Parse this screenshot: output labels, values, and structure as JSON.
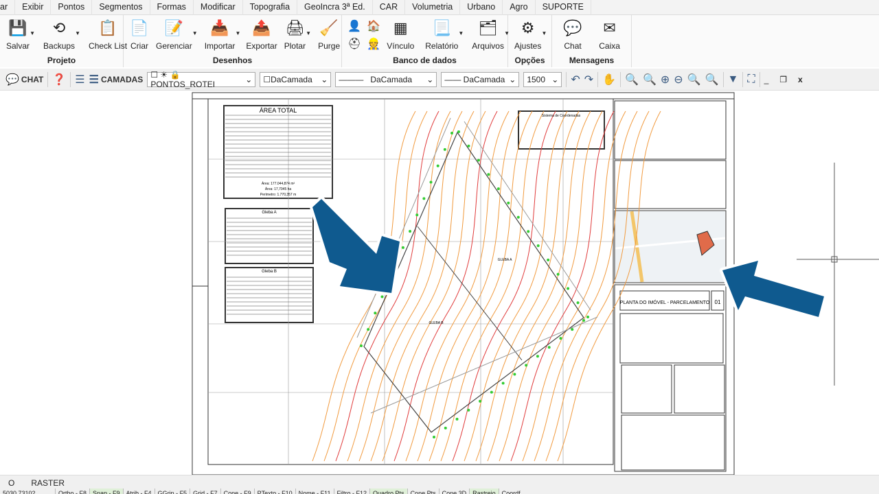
{
  "menu": [
    "ar",
    "Exibir",
    "Pontos",
    "Segmentos",
    "Formas",
    "Modificar",
    "Topografia",
    "GeoIncra 3ª Ed.",
    "CAR",
    "Volumetria",
    "Urbano",
    "Agro",
    "SUPORTE"
  ],
  "ribbon": {
    "projeto": {
      "title": "Projeto",
      "buttons": [
        "Salvar",
        "Backups",
        "Check List"
      ]
    },
    "desenhos": {
      "title": "Desenhos",
      "buttons": [
        "Criar",
        "Gerenciar",
        "Importar",
        "Exportar",
        "Plotar",
        "Purge"
      ]
    },
    "banco": {
      "title": "Banco de dados",
      "buttons": [
        "Vínculo",
        "Relatório",
        "Arquivos"
      ]
    },
    "opcoes": {
      "title": "Opções",
      "buttons": [
        "Ajustes"
      ]
    },
    "mensagens": {
      "title": "Mensagens",
      "buttons": [
        "Chat",
        "Caixa"
      ]
    }
  },
  "toolbar": {
    "chat": "CHAT",
    "camadas": "CAMADAS",
    "layer": "PONTOS_ROTEI",
    "color": "DaCamada",
    "linetype": "DaCamada",
    "lineweight": "DaCamada",
    "scale": "1500"
  },
  "drawing": {
    "area_total_title": "ÁREA TOTAL",
    "area": "Área: 177.044,874 m²",
    "area_ha": "Área: 17,7045 ha",
    "perimetro": "Perímetro: 1.770,357 m",
    "gleba_a_table": "Gleba A",
    "gleba_b_table": "Gleba B",
    "gleba_a": "GLEBA A",
    "gleba_b": "GLEBA B",
    "title_block": "PLANTA DO IMÓVEL - PARCELAMENTO",
    "sheet": "01",
    "coord_system": "Sistema de Coordenadas"
  },
  "arrow_color": "#0f5a8f",
  "tabs": [
    "O",
    "RASTER"
  ],
  "status": [
    "5030.73102",
    "Ortho - F8",
    "Snap - F9",
    "Atrib - F4",
    "GGrip - F5",
    "Grid - F7",
    "Cone - F9",
    "PTexto - F10",
    "Nome - F11",
    "Filtro - F12",
    "Quadro Pts",
    "Cone Pts",
    "Cone 3D",
    "Rastreio",
    "Coordf"
  ]
}
